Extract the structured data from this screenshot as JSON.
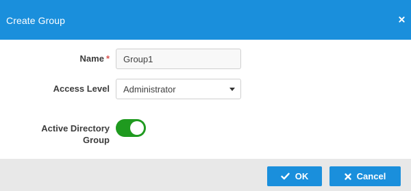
{
  "dialog": {
    "title": "Create Group",
    "close_icon": "close-icon"
  },
  "form": {
    "name": {
      "label": "Name",
      "required_marker": "*",
      "value": "Group1"
    },
    "access_level": {
      "label": "Access Level",
      "selected": "Administrator",
      "caret_icon": "caret-down-icon"
    },
    "active_directory": {
      "label_line1": "Active Directory",
      "label_line2": "Group",
      "enabled": true
    }
  },
  "footer": {
    "ok_label": "OK",
    "ok_icon": "check-icon",
    "cancel_label": "Cancel",
    "cancel_icon": "close-icon"
  },
  "colors": {
    "header": "#1a8fdc",
    "button": "#1a8fdc",
    "toggle_on": "#1f9a1f",
    "required": "#d9534f",
    "footer_bg": "#e8e8e8"
  }
}
